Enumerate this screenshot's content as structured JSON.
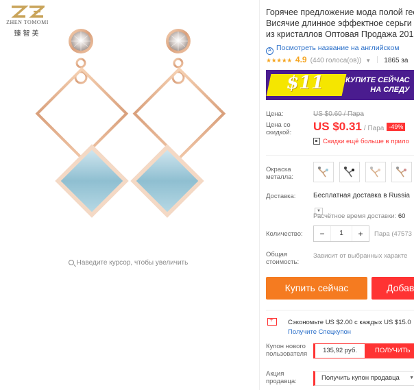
{
  "brand": {
    "name": "ZHEN TOMOMI",
    "name_cn": "臻智美",
    "logo_color": "#c9a45a"
  },
  "gallery": {
    "zoom_hint": "Наведите курсор, чтобы увеличить"
  },
  "product": {
    "title_lines": [
      "Горячее предложение мода полой гео",
      "Висячие длинное эффектное серьги д",
      "из кристаллов Оптовая Продажа 2018"
    ],
    "translate_link": "Посмотреть название на английском",
    "rating_stars": "★★★★★",
    "rating": "4.9",
    "votes": "(440 голоса(ов))",
    "orders": "1865 за"
  },
  "promo": {
    "amount": "$11",
    "line1": "КУПИТЕ СЕЙЧАС",
    "line2": "НА СЛЕДУ",
    "bg_color": "#4a1c8f",
    "badge_color": "#f5e600"
  },
  "pricing": {
    "price_label": "Цена:",
    "discount_label_1": "Цена со",
    "discount_label_2": "скидкой:",
    "old_price": "US $0.60 / Пара",
    "price": "US $0.31",
    "unit": "/ Пара",
    "discount": "-49%",
    "app_discount": "Скидки ещё больше в прило",
    "accent_color": "#ff3333"
  },
  "options": {
    "color_label_1": "Окраска",
    "color_label_2": "металла:",
    "swatch_names": [
      "swatch-1",
      "swatch-2",
      "swatch-3",
      "swatch-4"
    ]
  },
  "shipping": {
    "label": "Доставка:",
    "value": "Бесплатная доставка в Russia",
    "time": "Расчётное время доставки:",
    "time_value": "60"
  },
  "quantity": {
    "label": "Количество:",
    "minus": "−",
    "value": "1",
    "plus": "+",
    "available": "Пара (47573"
  },
  "total": {
    "label_1": "Общая",
    "label_2": "стоимость:",
    "value": "Зависит от выбранных характе"
  },
  "actions": {
    "buy_now": "Купить сейчас",
    "add_to_cart": "Добав",
    "buy_color": "#f57b20"
  },
  "savings": {
    "text": "Сэкономьте US $2.00 с каждых US $15.0",
    "link": "Получите Спецкупон"
  },
  "coupon": {
    "label_1": "Купон нового",
    "label_2": "пользователя",
    "amount": "135,92 руб.",
    "button": "ПОЛУЧИТЬ"
  },
  "seller_promo": {
    "label_1": "Акция",
    "label_2": "продавца:",
    "select": "Получить купон продавца",
    "caret": "▼"
  }
}
